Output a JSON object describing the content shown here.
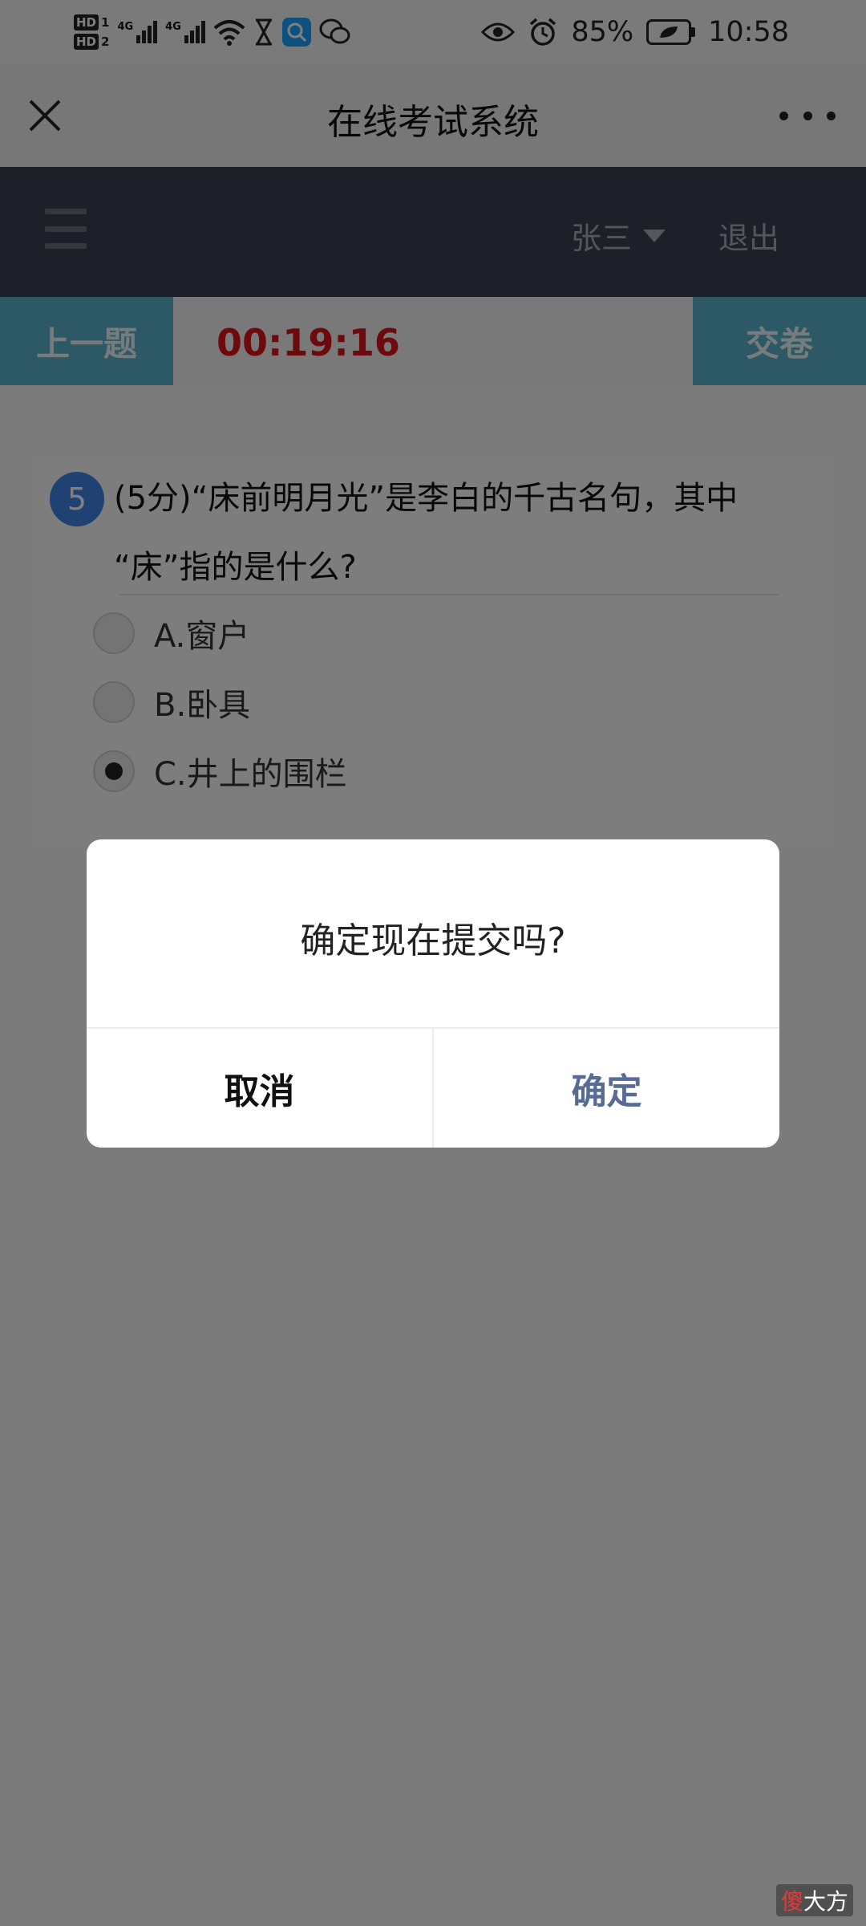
{
  "status_bar": {
    "sim1_label": "HD",
    "sim1_index": "1",
    "sim2_label": "HD",
    "sim2_index": "2",
    "network1": "4G",
    "network2": "4G",
    "battery": "85%",
    "time": "10:58",
    "icons": [
      "signal-icon",
      "wifi-icon",
      "hourglass-icon",
      "search-app-icon",
      "wechat-icon",
      "eye-icon",
      "alarm-icon",
      "battery-icon"
    ]
  },
  "titlebar": {
    "title": "在线考试系统"
  },
  "header": {
    "user": "张三",
    "logout": "退出"
  },
  "toolbar": {
    "prev_label": "上一题",
    "timer": "00:19:16",
    "submit_label": "交卷"
  },
  "question": {
    "number": "5",
    "text": "(5分)“床前明月光”是李白的千古名句，其中 “床”指的是什么?",
    "options": [
      {
        "label": "A.窗户",
        "selected": false
      },
      {
        "label": "B.卧具",
        "selected": false
      },
      {
        "label": "C.井上的围栏",
        "selected": true
      }
    ]
  },
  "dialog": {
    "message": "确定现在提交吗?",
    "cancel": "取消",
    "confirm": "确定"
  },
  "watermark": {
    "first": "傻",
    "rest": "大方"
  },
  "colors": {
    "accent_button": "#5bb0cc",
    "timer": "#d9141a",
    "header_dark": "#3a3f52",
    "question_badge": "#3f84e5",
    "dialog_confirm": "#576b95"
  }
}
